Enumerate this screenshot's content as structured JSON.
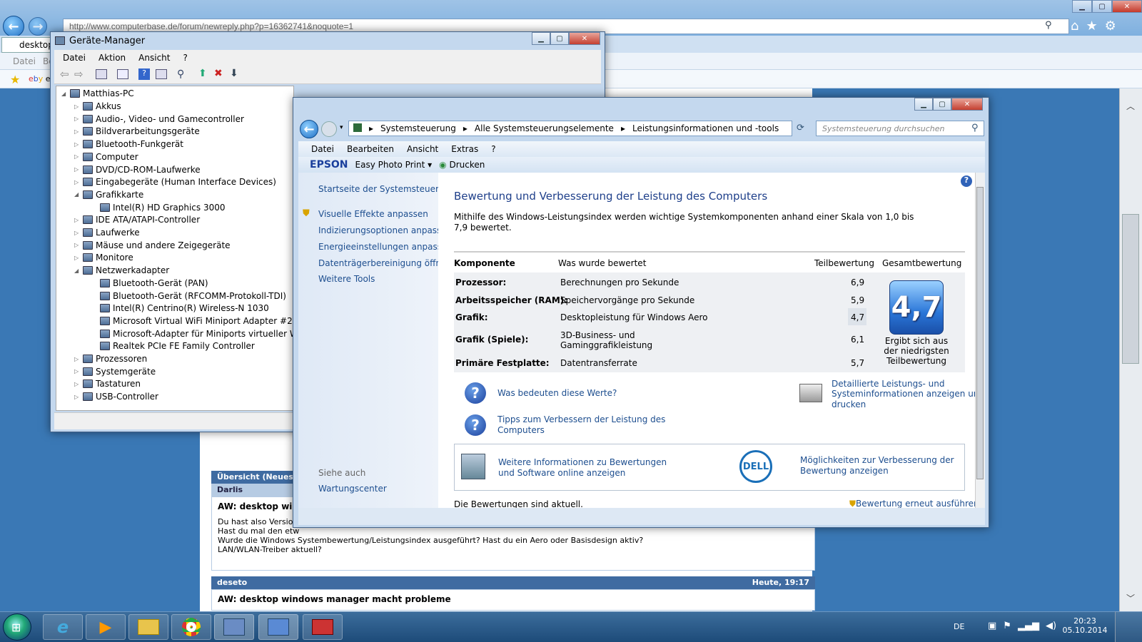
{
  "browser": {
    "url": "http://www.computerbase.de/forum/newreply.php?p=16362741&noquote=1",
    "tab_label": "desktop",
    "menu": [
      "Datei",
      "Be"
    ],
    "fav_item": "eB",
    "window_controls": {
      "minimize": "▁",
      "maximize": "▢",
      "close": "✕"
    }
  },
  "forum": {
    "overview_header": "Übersicht (Neuester",
    "post1": {
      "author": "Darlis",
      "title": "AW: desktop windo",
      "lines": [
        "Du hast also Version",
        "Hast du mal den etw",
        "Wurde die Windows Systembewertung/Leistungsindex ausgeführt? Hast du ein Aero oder Basisdesign aktiv?",
        "LAN/WLAN-Treiber aktuell?"
      ]
    },
    "post2": {
      "author": "deseto",
      "time": "Heute, 19:17",
      "title": "AW: desktop windows manager macht probleme"
    }
  },
  "device_manager": {
    "title": "Geräte-Manager",
    "menu": [
      "Datei",
      "Aktion",
      "Ansicht",
      "?"
    ],
    "root": "Matthias-PC",
    "nodes": [
      {
        "label": "Akkus",
        "level": 1
      },
      {
        "label": "Audio-, Video- und Gamecontroller",
        "level": 1
      },
      {
        "label": "Bildverarbeitungsgeräte",
        "level": 1
      },
      {
        "label": "Bluetooth-Funkgerät",
        "level": 1
      },
      {
        "label": "Computer",
        "level": 1
      },
      {
        "label": "DVD/CD-ROM-Laufwerke",
        "level": 1
      },
      {
        "label": "Eingabegeräte (Human Interface Devices)",
        "level": 1
      },
      {
        "label": "Grafikkarte",
        "level": 1
      },
      {
        "label": "Intel(R) HD Graphics 3000",
        "level": 2
      },
      {
        "label": "IDE ATA/ATAPI-Controller",
        "level": 1
      },
      {
        "label": "Laufwerke",
        "level": 1
      },
      {
        "label": "Mäuse und andere Zeigegeräte",
        "level": 1
      },
      {
        "label": "Monitore",
        "level": 1
      },
      {
        "label": "Netzwerkadapter",
        "level": 1
      },
      {
        "label": "Bluetooth-Gerät (PAN)",
        "level": 2
      },
      {
        "label": "Bluetooth-Gerät (RFCOMM-Protokoll-TDI)",
        "level": 2
      },
      {
        "label": "Intel(R) Centrino(R) Wireless-N 1030",
        "level": 2
      },
      {
        "label": "Microsoft Virtual WiFi Miniport Adapter #2",
        "level": 2
      },
      {
        "label": "Microsoft-Adapter für Miniports virtueller WiFis",
        "level": 2
      },
      {
        "label": "Realtek PCIe FE Family Controller",
        "level": 2
      },
      {
        "label": "Prozessoren",
        "level": 1
      },
      {
        "label": "Systemgeräte",
        "level": 1
      },
      {
        "label": "Tastaturen",
        "level": 1
      },
      {
        "label": "USB-Controller",
        "level": 1
      }
    ]
  },
  "perf": {
    "breadcrumb": [
      "Systemsteuerung",
      "Alle Systemsteuerungselemente",
      "Leistungsinformationen und -tools"
    ],
    "search_placeholder": "Systemsteuerung durchsuchen",
    "menu": [
      "Datei",
      "Bearbeiten",
      "Ansicht",
      "Extras",
      "?"
    ],
    "epson": {
      "brand": "EPSON",
      "app": "Easy Photo Print",
      "print": "Drucken"
    },
    "left": {
      "home": "Startseite der Systemsteuerung",
      "tasks": [
        "Visuelle Effekte anpassen",
        "Indizierungsoptionen anpassen",
        "Energieeinstellungen anpassen",
        "Datenträgerbereinigung öffnen",
        "Weitere Tools"
      ],
      "see_also": "Siehe auch",
      "maintenance": "Wartungscenter"
    },
    "heading": "Bewertung und Verbesserung der Leistung des Computers",
    "intro1": "Mithilfe des Windows-Leistungsindex werden wichtige Systemkomponenten anhand einer Skala von 1,0 bis",
    "intro2": "7,9 bewertet.",
    "table_headers": {
      "component": "Komponente",
      "rated": "Was wurde bewertet",
      "sub": "Teilbewertung",
      "total": "Gesamtbewertung"
    },
    "rows": [
      {
        "component": "Prozessor:",
        "rated": "Berechnungen pro Sekunde",
        "score": "6,9"
      },
      {
        "component": "Arbeitsspeicher (RAM):",
        "rated": "Speichervorgänge pro Sekunde",
        "score": "5,9"
      },
      {
        "component": "Grafik:",
        "rated": "Desktopleistung für Windows Aero",
        "score": "4,7"
      },
      {
        "component": "Grafik (Spiele):",
        "rated": "3D-Business- und",
        "rated2": "Gaminggrafikleistung",
        "score": "6,1"
      },
      {
        "component": "Primäre Festplatte:",
        "rated": "Datentransferrate",
        "score": "5,7"
      }
    ],
    "base_score": "4,7",
    "base_note": [
      "Ergibt sich aus",
      "der niedrigsten",
      "Teilbewertung"
    ],
    "links": {
      "meaning": "Was bedeuten diese Werte?",
      "tips1": "Tipps zum Verbessern der Leistung des",
      "tips2": "Computers",
      "detail1": "Detaillierte Leistungs- und",
      "detail2": "Systeminformationen anzeigen und",
      "detail3": "drucken",
      "online1": "Weitere Informationen zu Bewertungen",
      "online2": "und Software online anzeigen",
      "improve1": "Möglichkeiten zur Verbesserung der",
      "improve2": "Bewertung anzeigen",
      "dell": "DELL"
    },
    "status": "Die Bewertungen sind aktuell.",
    "rerun": "Bewertung erneut ausführen"
  },
  "taskbar": {
    "lang": "DE",
    "time": "20:23",
    "date": "05.10.2014"
  }
}
